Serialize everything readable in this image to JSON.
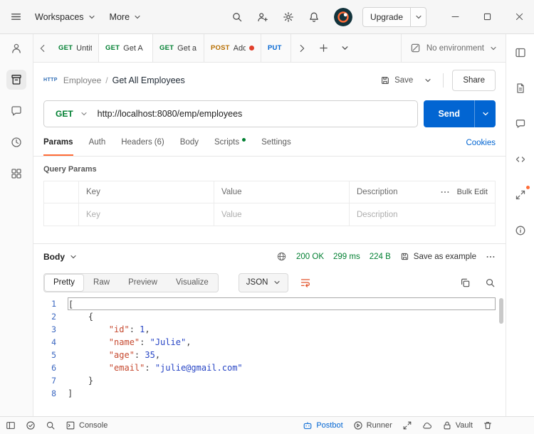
{
  "colors": {
    "accent_orange": "#ff6c37",
    "primary_blue": "#0265d2",
    "success_green": "#007f31",
    "method_post": "#b76e00",
    "method_put": "#0265d2",
    "code_key": "#c6492f",
    "code_string": "#2745c5",
    "code_number": "#2745c5",
    "line_number": "#3a66c0"
  },
  "titlebar": {
    "workspaces_label": "Workspaces",
    "more_label": "More",
    "upgrade_label": "Upgrade"
  },
  "tabbar": {
    "tabs": [
      {
        "method": "GET",
        "label": "Untitl",
        "dirty": false
      },
      {
        "method": "GET",
        "label": "Get A",
        "dirty": false
      },
      {
        "method": "GET",
        "label": "Get a",
        "dirty": false
      },
      {
        "method": "POST",
        "label": "Add",
        "dirty": true
      },
      {
        "method": "PUT",
        "label": "",
        "dirty": false
      }
    ],
    "active_tab_index": 1,
    "environment_label": "No environment"
  },
  "request": {
    "collection_name": "Employee",
    "breadcrumb_separator": "/",
    "request_name": "Get All Employees",
    "save_label": "Save",
    "share_label": "Share",
    "method": "GET",
    "url": "http://localhost:8080/emp/employees",
    "send_label": "Send",
    "tabs": [
      {
        "label": "Params"
      },
      {
        "label": "Auth"
      },
      {
        "label": "Headers",
        "count": "(6)"
      },
      {
        "label": "Body"
      },
      {
        "label": "Scripts"
      },
      {
        "label": "Settings"
      }
    ],
    "cookies_label": "Cookies",
    "query_params_title": "Query Params",
    "params_table": {
      "headers": [
        "Key",
        "Value",
        "Description"
      ],
      "bulk_edit_label": "Bulk Edit",
      "row_placeholders": [
        "Key",
        "Value",
        "Description"
      ]
    }
  },
  "response": {
    "body_label": "Body",
    "status": "200 OK",
    "time": "299 ms",
    "size": "224 B",
    "save_as_example_label": "Save as example",
    "view_tabs": [
      "Pretty",
      "Raw",
      "Preview",
      "Visualize"
    ],
    "active_view_tab": "Pretty",
    "format_label": "JSON",
    "code_lines": [
      {
        "num": "1",
        "active": true,
        "tokens": [
          [
            "[",
            "p"
          ]
        ]
      },
      {
        "num": "2",
        "active": false,
        "tokens": [
          [
            "    {",
            "p"
          ]
        ]
      },
      {
        "num": "3",
        "active": false,
        "tokens": [
          [
            "        ",
            "p"
          ],
          [
            "\"id\"",
            "k"
          ],
          [
            ": ",
            "p"
          ],
          [
            "1",
            "n"
          ],
          [
            ",",
            "p"
          ]
        ]
      },
      {
        "num": "4",
        "active": false,
        "tokens": [
          [
            "        ",
            "p"
          ],
          [
            "\"name\"",
            "k"
          ],
          [
            ": ",
            "p"
          ],
          [
            "\"Julie\"",
            "s"
          ],
          [
            ",",
            "p"
          ]
        ]
      },
      {
        "num": "5",
        "active": false,
        "tokens": [
          [
            "        ",
            "p"
          ],
          [
            "\"age\"",
            "k"
          ],
          [
            ": ",
            "p"
          ],
          [
            "35",
            "n"
          ],
          [
            ",",
            "p"
          ]
        ]
      },
      {
        "num": "6",
        "active": false,
        "tokens": [
          [
            "        ",
            "p"
          ],
          [
            "\"email\"",
            "k"
          ],
          [
            ": ",
            "p"
          ],
          [
            "\"julie@gmail.com\"",
            "s"
          ]
        ]
      },
      {
        "num": "7",
        "active": false,
        "tokens": [
          [
            "    }",
            "p"
          ]
        ]
      },
      {
        "num": "8",
        "active": false,
        "tokens": [
          [
            "]",
            "p"
          ]
        ]
      }
    ]
  },
  "statusbar": {
    "console_label": "Console",
    "postbot_label": "Postbot",
    "runner_label": "Runner",
    "vault_label": "Vault"
  }
}
